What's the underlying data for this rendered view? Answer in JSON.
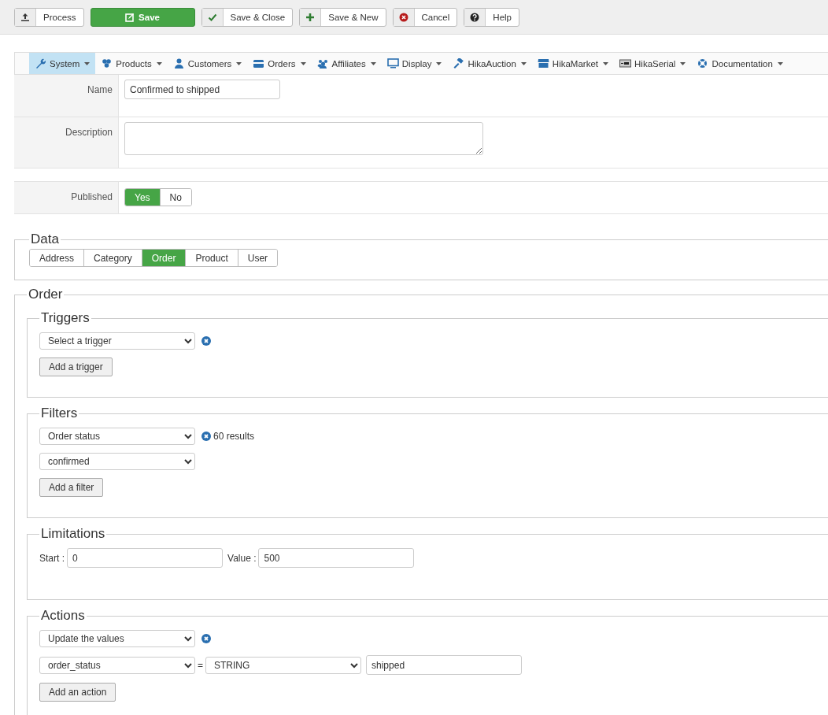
{
  "toolbar": [
    {
      "label": "Process",
      "kind": "default"
    },
    {
      "label": "Save",
      "kind": "primary"
    },
    {
      "label": "Save & Close",
      "kind": "default"
    },
    {
      "label": "Save & New",
      "kind": "default"
    },
    {
      "label": "Cancel",
      "kind": "default"
    },
    {
      "label": "Help",
      "kind": "default"
    }
  ],
  "menu": [
    {
      "label": "System",
      "selected": true
    },
    {
      "label": "Products",
      "selected": false
    },
    {
      "label": "Customers",
      "selected": false
    },
    {
      "label": "Orders",
      "selected": false
    },
    {
      "label": "Affiliates",
      "selected": false
    },
    {
      "label": "Display",
      "selected": false
    },
    {
      "label": "HikaAuction",
      "selected": false
    },
    {
      "label": "HikaMarket",
      "selected": false
    },
    {
      "label": "HikaSerial",
      "selected": false
    },
    {
      "label": "Documentation",
      "selected": false
    }
  ],
  "form": {
    "name": {
      "label": "Name",
      "value": "Confirmed to shipped"
    },
    "description": {
      "label": "Description"
    },
    "published": {
      "label": "Published",
      "options": [
        {
          "label": "Yes",
          "selected": true
        },
        {
          "label": "No",
          "selected": false
        }
      ]
    }
  },
  "data": {
    "legend": "Data",
    "tabs": [
      {
        "label": "Address",
        "selected": false
      },
      {
        "label": "Category",
        "selected": false
      },
      {
        "label": "Order",
        "selected": true
      },
      {
        "label": "Product",
        "selected": false
      },
      {
        "label": "User",
        "selected": false
      }
    ]
  },
  "order": {
    "legend": "Order",
    "triggers": {
      "legend": "Triggers",
      "select": "Select a trigger",
      "button": "Add a trigger"
    },
    "filters": {
      "legend": "Filters",
      "select": "Order status",
      "results": "60 results",
      "value_select": "confirmed",
      "button": "Add a filter"
    },
    "limitations": {
      "legend": "Limitations",
      "start_label": "Start :",
      "start": "0",
      "value_label": "Value :",
      "value": "500"
    },
    "actions": {
      "legend": "Actions",
      "select": "Update the values",
      "field_select": "order_status",
      "equals": "=",
      "type_select": "STRING",
      "value": "shipped",
      "button": "Add an action"
    }
  }
}
